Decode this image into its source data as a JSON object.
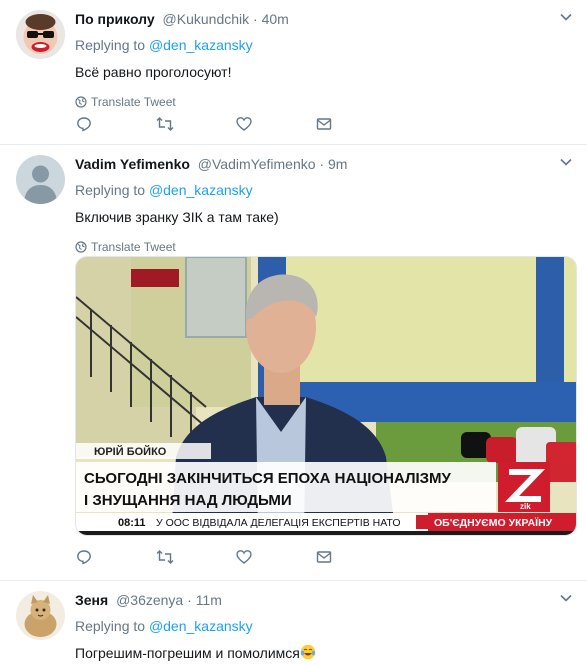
{
  "tweets": [
    {
      "name": "По приколу",
      "handle": "@Kukundchik",
      "dot": "·",
      "time": "40m",
      "replying_prefix": "Replying to",
      "replying_to": "@den_kazansky",
      "text": "Всё равно проголосуют!",
      "translate": "Translate Tweet"
    },
    {
      "name": "Vadim Yefimenko",
      "handle": "@VadimYefimenko",
      "dot": "·",
      "time": "9m",
      "replying_prefix": "Replying to",
      "replying_to": "@den_kazansky",
      "text": "Включив зранку ЗІК а там таке)",
      "translate": "Translate Tweet",
      "media": {
        "caption_name": "ЮРІЙ БОЙКО",
        "headline_line1": "СЬОГОДНІ ЗАКІНЧИТЬСЯ ЕПОХА НАЦІОНАЛІЗМУ",
        "headline_line2": "І ЗНУЩАННЯ НАД ЛЮДЬМИ",
        "ticker_time": "08:11",
        "ticker_text": "У ООС ВІДВІДАЛА ДЕЛЕГАЦІЯ ЕКСПЕРТІВ НАТО",
        "ticker_slogan": "ОБ'ЄДНУЄМО УКРАЇНУ",
        "channel_logo": "zik"
      }
    },
    {
      "name": "Зеня",
      "handle": "@36zenya",
      "dot": "·",
      "time": "11m",
      "replying_prefix": "Replying to",
      "replying_to": "@den_kazansky",
      "text": "Погрешим-погрешим и помолимся"
    }
  ],
  "colors": {
    "link": "#1da1f2",
    "secondary": "#657786",
    "zik_red": "#d01d2e"
  }
}
